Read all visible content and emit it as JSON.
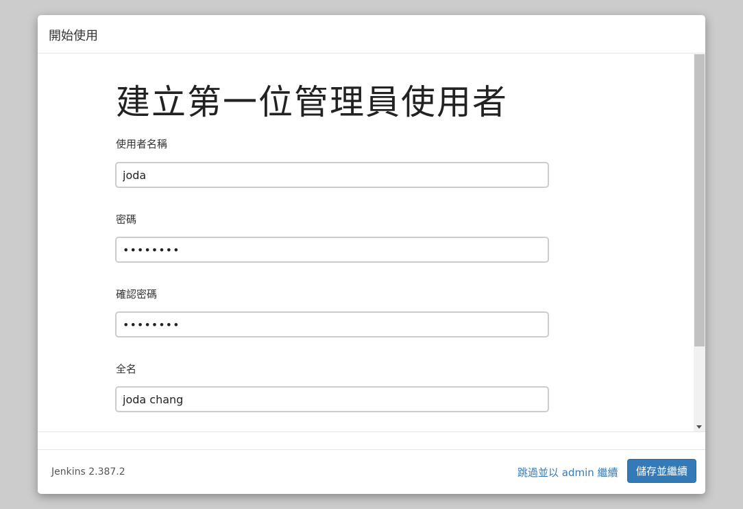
{
  "dialog": {
    "title": "開始使用"
  },
  "form": {
    "heading": "建立第一位管理員使用者",
    "fields": [
      {
        "label": "使用者名稱",
        "value": "joda",
        "type": "text"
      },
      {
        "label": "密碼",
        "value": "••••••••",
        "type": "password"
      },
      {
        "label": "確認密碼",
        "value": "••••••••",
        "type": "password"
      },
      {
        "label": "全名",
        "value": "joda chang",
        "type": "text"
      }
    ]
  },
  "footer": {
    "version": "Jenkins 2.387.2",
    "skip_label": "跳過並以 admin 繼續",
    "save_label": "儲存並繼續"
  },
  "icons": {
    "scroll_down": "chevron-down-icon"
  },
  "colors": {
    "primary": "#337ab7",
    "backdrop": "#cccccc"
  }
}
